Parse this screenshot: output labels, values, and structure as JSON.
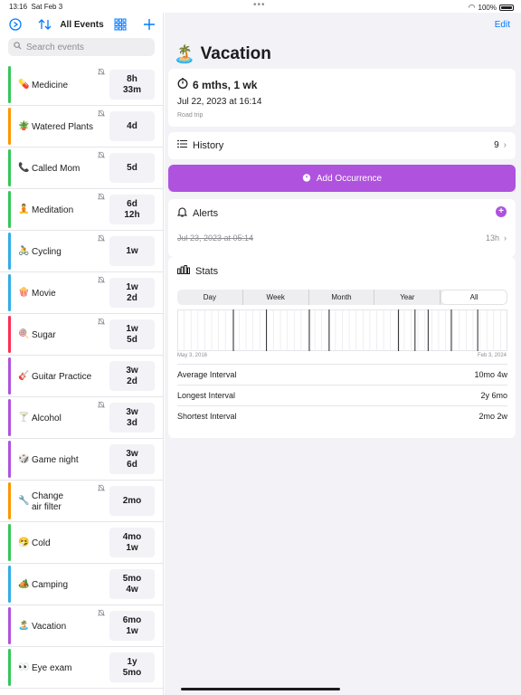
{
  "status_bar": {
    "time": "13:16",
    "date": "Sat Feb 3",
    "battery": "100%"
  },
  "sidebar": {
    "title": "All Events",
    "search_placeholder": "Search events",
    "events": [
      {
        "emoji": "💊",
        "name": "Medicine",
        "interval": "8h\n33m",
        "color": "#34c759",
        "muted": true
      },
      {
        "emoji": "🪴",
        "name": "Watered Plants",
        "interval": "4d",
        "color": "#ff9500",
        "muted": true
      },
      {
        "emoji": "📞",
        "name": "Called Mom",
        "interval": "5d",
        "color": "#34c759",
        "muted": true
      },
      {
        "emoji": "🧘",
        "name": "Meditation",
        "interval": "6d\n12h",
        "color": "#34c759",
        "muted": true
      },
      {
        "emoji": "🚴",
        "name": "Cycling",
        "interval": "1w",
        "color": "#32ade6",
        "muted": true
      },
      {
        "emoji": "🍿",
        "name": "Movie",
        "interval": "1w\n2d",
        "color": "#32ade6",
        "muted": true
      },
      {
        "emoji": "🍭",
        "name": "Sugar",
        "interval": "1w\n5d",
        "color": "#ff2d55",
        "muted": true
      },
      {
        "emoji": "🎸",
        "name": "Guitar Practice",
        "interval": "3w\n2d",
        "color": "#af52de",
        "muted": false
      },
      {
        "emoji": "🍸",
        "name": "Alcohol",
        "interval": "3w\n3d",
        "color": "#af52de",
        "muted": true
      },
      {
        "emoji": "🎲",
        "name": "Game night",
        "interval": "3w\n6d",
        "color": "#af52de",
        "muted": false
      },
      {
        "emoji": "🔧",
        "name": "Change\nair filter",
        "interval": "2mo",
        "color": "#ff9500",
        "muted": true
      },
      {
        "emoji": "🤧",
        "name": "Cold",
        "interval": "4mo\n1w",
        "color": "#34c759",
        "muted": false
      },
      {
        "emoji": "🏕️",
        "name": "Camping",
        "interval": "5mo\n4w",
        "color": "#32ade6",
        "muted": false
      },
      {
        "emoji": "🏝️",
        "name": "Vacation",
        "interval": "6mo\n1w",
        "color": "#af52de",
        "muted": true
      },
      {
        "emoji": "👀",
        "name": "Eye exam",
        "interval": "1y\n5mo",
        "color": "#34c759",
        "muted": false
      }
    ]
  },
  "detail": {
    "edit_label": "Edit",
    "emoji": "🏝️",
    "title": "Vacation",
    "duration": "6 mths, 1 wk",
    "date": "Jul 22, 2023 at 16:14",
    "note": "Road trip",
    "history_label": "History",
    "history_count": "9",
    "add_label": "Add Occurrence",
    "alerts_label": "Alerts",
    "alert_date": "Jul 23, 2023 at 05:14",
    "alert_relative": "13h",
    "stats_label": "Stats",
    "segments": [
      "Day",
      "Week",
      "Month",
      "Year",
      "All"
    ],
    "active_segment": "All",
    "timeline_start": "May 3, 2016",
    "timeline_end": "Feb 3, 2024",
    "occurrence_positions": [
      0.17,
      0.27,
      0.4,
      0.46,
      0.67,
      0.72,
      0.76,
      0.83,
      0.91
    ],
    "stats_rows": [
      {
        "key": "Average Interval",
        "value": "10mo 4w"
      },
      {
        "key": "Longest Interval",
        "value": "2y 6mo"
      },
      {
        "key": "Shortest Interval",
        "value": "2mo 2w"
      }
    ]
  },
  "colors": {
    "accent": "#007aff",
    "purple": "#af52de",
    "background": "#f2f2f7"
  }
}
